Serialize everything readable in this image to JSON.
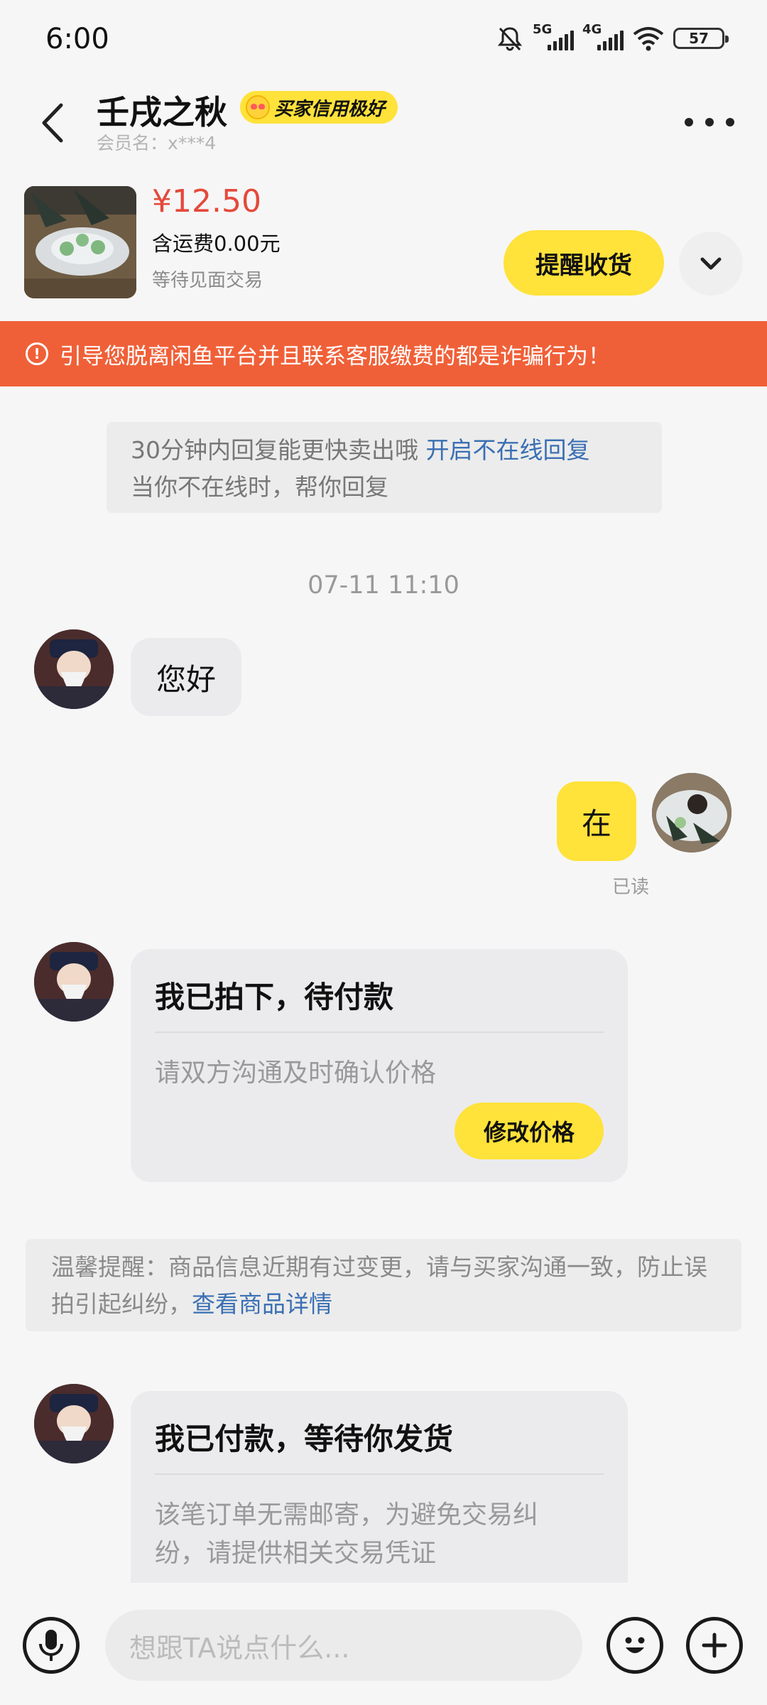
{
  "status_bar": {
    "time": "6:00",
    "signal_1": "5G",
    "signal_2": "4G",
    "battery": "57"
  },
  "header": {
    "name": "壬戌之秋",
    "credit_badge": "买家信用极好",
    "member_label": "会员名：x***4"
  },
  "product": {
    "price": "¥12.50",
    "shipping": "含运费0.00元",
    "trade_mode": "等待见面交易",
    "remind_button": "提醒收货"
  },
  "warning": {
    "text": "引导您脱离闲鱼平台并且联系客服缴费的都是诈骗行为！"
  },
  "chat": {
    "system_notice": {
      "text": "30分钟内回复能更快卖出哦",
      "link": "开启不在线回复",
      "line2": "当你不在线时，帮你回复"
    },
    "timestamp": "07-11 11:10",
    "msg_hello": "您好",
    "msg_reply": "在",
    "read_status": "已读",
    "card1": {
      "title": "我已拍下，待付款",
      "body": "请双方沟通及时确认价格",
      "button": "修改价格"
    },
    "tip": {
      "text": "温馨提醒：商品信息近期有过变更，请与买家沟通一致，防止误拍引起纠纷，",
      "link": "查看商品详情"
    },
    "card2": {
      "title": "我已付款，等待你发货",
      "body_line1": "该笔订单无需邮寄，为避免交易纠",
      "body_line2": "纷，请提供相关交易凭证"
    }
  },
  "input": {
    "placeholder": "想跟TA说点什么..."
  },
  "colors": {
    "accent_yellow": "#ffe23a",
    "price_red": "#e4493b",
    "warning_orange": "#f06038",
    "link_blue": "#3a6fb3"
  }
}
